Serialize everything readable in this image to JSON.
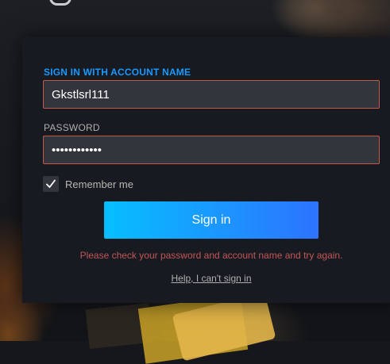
{
  "login": {
    "account_label": "SIGN IN WITH ACCOUNT NAME",
    "account_value": "Gkstlsrl111",
    "password_label": "PASSWORD",
    "password_value": "••••••••••••",
    "remember_label": "Remember me",
    "remember_checked": true,
    "sign_in_label": "Sign in",
    "error_message": "Please check your password and account name and try again.",
    "help_link": "Help, I can't sign in"
  },
  "icons": {
    "checkbox": "checkmark-icon"
  },
  "colors": {
    "accent_blue": "#1999ff",
    "button_gradient_start": "#06bfff",
    "button_gradient_end": "#2d73ff",
    "error_red": "#c15755",
    "field_border_error": "#c8574a",
    "panel_bg": "#181a21",
    "field_bg": "#32353c"
  }
}
